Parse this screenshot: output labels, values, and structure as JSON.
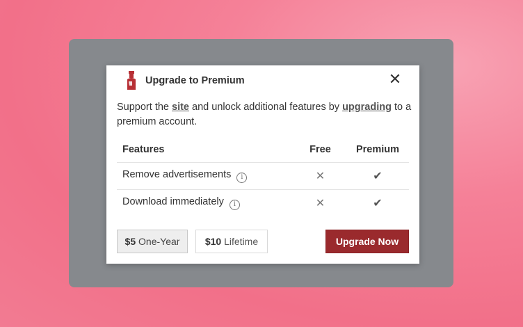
{
  "modal": {
    "title": "Upgrade to Premium",
    "close_glyph": "✕",
    "description": {
      "part1": "Support the ",
      "link1": "site",
      "part2": " and unlock additional features by ",
      "link2": "upgrading",
      "part3": " to a premium account."
    },
    "table": {
      "headers": [
        "Features",
        "Free",
        "Premium"
      ],
      "rows": [
        {
          "feature": "Remove advertisements",
          "free": "✕",
          "premium": "✔"
        },
        {
          "feature": "Download immediately",
          "free": "✕",
          "premium": "✔"
        }
      ],
      "info_glyph": "i"
    },
    "buttons": {
      "one_year_price": "$5",
      "one_year_label": " One-Year",
      "lifetime_price": "$10",
      "lifetime_label": " Lifetime",
      "upgrade_label": "Upgrade Now"
    }
  },
  "colors": {
    "background": "#f27089",
    "backdrop": "#86898d",
    "accent": "#9a2a2d"
  }
}
